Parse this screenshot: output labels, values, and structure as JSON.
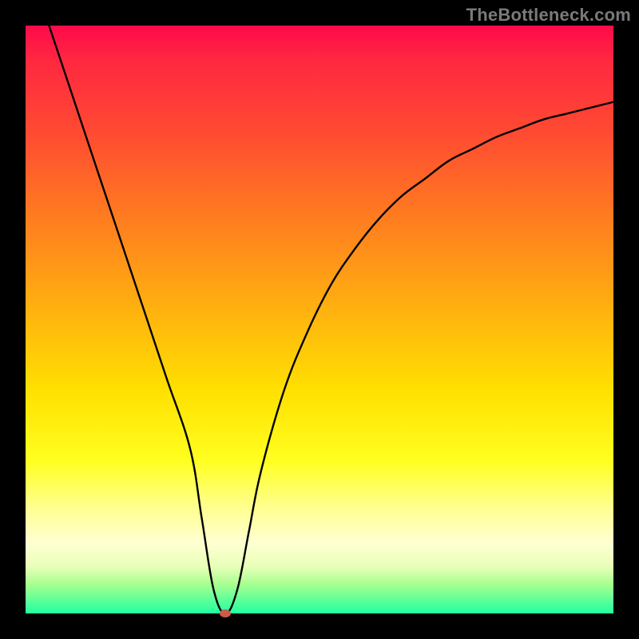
{
  "watermark": "TheBottleneck.com",
  "chart_data": {
    "type": "line",
    "title": "",
    "xlabel": "",
    "ylabel": "",
    "xlim": [
      0,
      100
    ],
    "ylim": [
      0,
      100
    ],
    "series": [
      {
        "name": "bottleneck-curve",
        "x": [
          4,
          8,
          12,
          16,
          20,
          24,
          28,
          30,
          32,
          34,
          36,
          38,
          40,
          44,
          48,
          52,
          56,
          60,
          64,
          68,
          72,
          76,
          80,
          84,
          88,
          92,
          96,
          100
        ],
        "y": [
          100,
          88,
          76,
          64,
          52,
          40,
          28,
          16,
          4,
          0,
          4,
          14,
          24,
          38,
          48,
          56,
          62,
          67,
          71,
          74,
          77,
          79,
          81,
          82.5,
          84,
          85,
          86,
          87
        ]
      }
    ],
    "marker": {
      "x": 34,
      "y": 0
    },
    "colors": {
      "curve": "#000000",
      "marker": "#cc5a4a",
      "gradient_top": "#ff0a4a",
      "gradient_bottom": "#20ffa0"
    }
  }
}
